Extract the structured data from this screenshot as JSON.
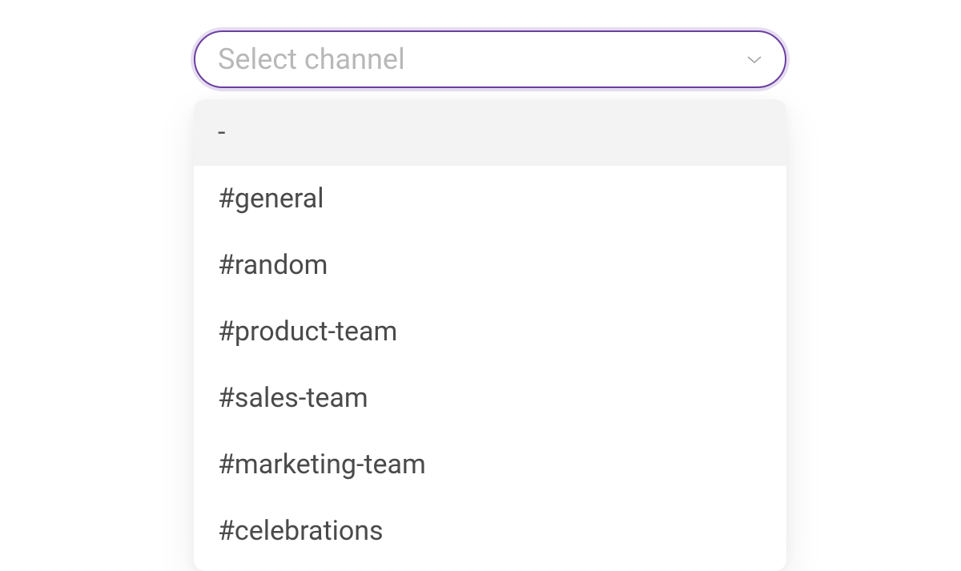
{
  "select": {
    "placeholder": "Select channel"
  },
  "dropdown": {
    "items": [
      {
        "label": "-",
        "highlighted": true
      },
      {
        "label": "#general",
        "highlighted": false
      },
      {
        "label": "#random",
        "highlighted": false
      },
      {
        "label": "#product-team",
        "highlighted": false
      },
      {
        "label": "#sales-team",
        "highlighted": false
      },
      {
        "label": "#marketing-team",
        "highlighted": false
      },
      {
        "label": "#celebrations",
        "highlighted": false
      }
    ]
  }
}
